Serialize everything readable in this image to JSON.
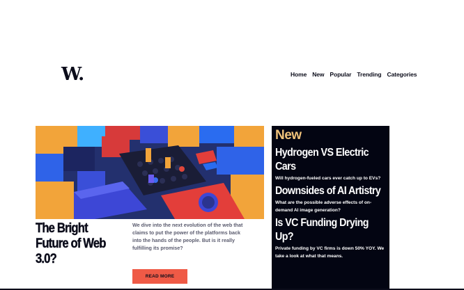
{
  "brand": {
    "logo_text": "W."
  },
  "nav": {
    "items": [
      {
        "label": "Home"
      },
      {
        "label": "New"
      },
      {
        "label": "Popular"
      },
      {
        "label": "Trending"
      },
      {
        "label": "Categories"
      }
    ]
  },
  "hero": {
    "image_description_icon": "abstract-3d-blocks-image",
    "title": "The Bright Future of Web 3.0?",
    "description": "We dive into the next evolution of the web that claims to put the power of the platforms back into the hands of the people. But is it really fulfilling its promise?",
    "cta_label": "READ MORE"
  },
  "new_panel": {
    "heading": "New",
    "items": [
      {
        "title": "Hydrogen VS Electric Cars",
        "description": "Will hydrogen-fueled cars ever catch up to EVs?"
      },
      {
        "title": "Downsides of AI Artistry",
        "description": "What are the possible adverse effects of on-demand AI image generation?"
      },
      {
        "title": "Is VC Funding Drying Up?",
        "description": "Private funding by VC firms is down 50% YOY. We take a look at what that means."
      }
    ]
  },
  "colors": {
    "accent_orange": "#ef5a46",
    "panel_bg": "#030512",
    "new_heading": "#f0c27a",
    "text_dark": "#0b0c1a",
    "text_muted": "#5a5b6e"
  }
}
